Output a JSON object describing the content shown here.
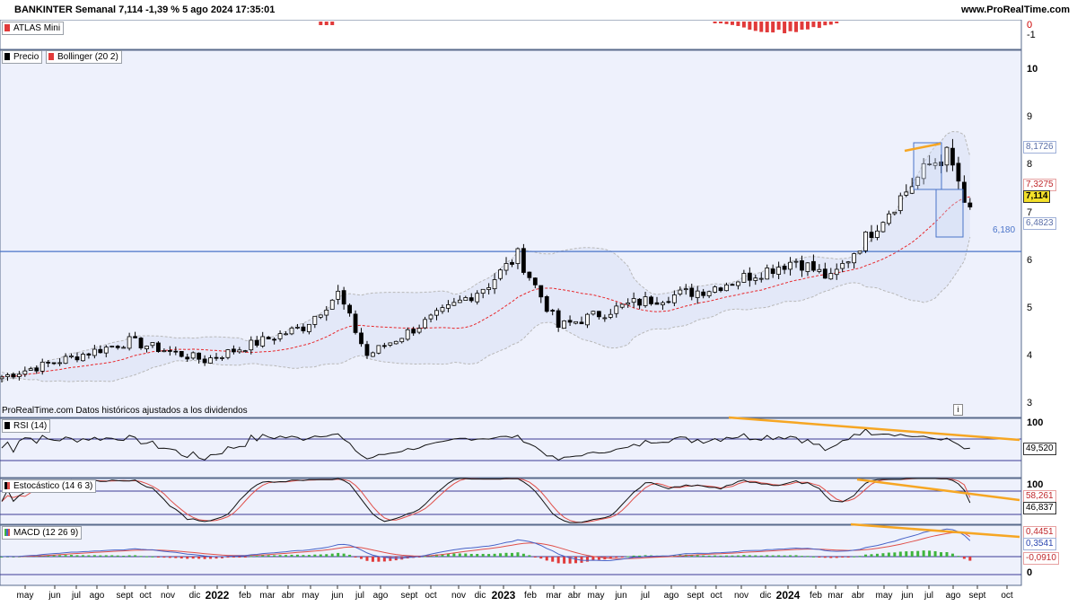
{
  "header": {
    "title": "BANKINTER Semanal 7,114 -1,39 % 5 ago 2024 17:35:01",
    "brand": "www.ProRealTime.com"
  },
  "panels": {
    "atlas": {
      "label": "ATLAS Mini",
      "ticks": [
        "0",
        "-1"
      ]
    },
    "price": {
      "legend_price": "Precio",
      "legend_bollinger": "Bollinger (20 2)",
      "footnote": "ProRealTime.com Datos históricos ajustados a los dividendos",
      "info_icon": "i",
      "level_label": "6,180",
      "tags": {
        "upper": "8,1726",
        "middle": "7,3275",
        "last": "7,114",
        "lower": "6,4823"
      }
    },
    "rsi": {
      "label": "RSI (14)",
      "tag": "49,520",
      "tick": "100"
    },
    "stoch": {
      "label": "Estocástico (14 6 3)",
      "tag_d": "58,261",
      "tag_k": "46,837",
      "tick": "100"
    },
    "macd": {
      "label": "MACD (12 26 9)",
      "tag_signal": "0,4451",
      "tag_macd": "0,3541",
      "tag_hist": "-0,0910",
      "tick": "0"
    }
  },
  "colors": {
    "up": "#ffffff",
    "down": "#000000",
    "bollinger_mid": "#e8262a",
    "bollinger_band": "#b8b8b8",
    "trendline": "#f6a623",
    "level": "#4a74c9",
    "panel_bg": "#e9eefb",
    "rsi_line": "#111111",
    "stoch_k": "#111111",
    "stoch_d": "#e0504a",
    "macd_line": "#4863c7",
    "signal_line": "#e0504a",
    "hist_pos": "#3fb53f",
    "hist_neg": "#e13a3a",
    "atlas": "#e13a3a"
  },
  "chart_data": {
    "type": "candlestick",
    "title": "BANKINTER Semanal 7,114 -1,39 % 5 ago 2024 17:35:01",
    "x_axis_labels": [
      "may",
      "jun",
      "jul",
      "ago",
      "sept",
      "oct",
      "nov",
      "dic",
      "2022",
      "feb",
      "mar",
      "abr",
      "may",
      "jun",
      "jul",
      "ago",
      "sept",
      "oct",
      "nov",
      "dic",
      "2023",
      "feb",
      "mar",
      "abr",
      "may",
      "jun",
      "jul",
      "ago",
      "sept",
      "oct",
      "nov",
      "dic",
      "2024",
      "feb",
      "mar",
      "abr",
      "may",
      "jun",
      "jul",
      "ago",
      "sept",
      "oct"
    ],
    "y_axis_price": {
      "ticks": [
        3,
        4,
        5,
        6,
        7,
        8,
        9,
        10
      ],
      "ylim": [
        2.7,
        10.4
      ]
    },
    "key_points": [
      {
        "x": "may 2021",
        "close": 3.55
      },
      {
        "x": "oct 2021",
        "close": 4.3
      },
      {
        "x": "ene 2022",
        "close": 3.9
      },
      {
        "x": "may 2022",
        "close": 4.6
      },
      {
        "x": "jun 2022",
        "close": 5.3
      },
      {
        "x": "jul 2022",
        "close": 4.0
      },
      {
        "x": "oct 2022",
        "close": 4.9
      },
      {
        "x": "dic 2022",
        "close": 5.5
      },
      {
        "x": "ene 2023",
        "close": 6.1
      },
      {
        "x": "mar 2023",
        "close": 4.6
      },
      {
        "x": "jun 2023",
        "close": 5.1
      },
      {
        "x": "sept 2023",
        "close": 5.4
      },
      {
        "x": "dic 2023",
        "close": 6.0
      },
      {
        "x": "feb 2024",
        "close": 5.6
      },
      {
        "x": "abr 2024",
        "close": 6.9
      },
      {
        "x": "jun 2024",
        "close": 8.0
      },
      {
        "x": "jul 2024",
        "close": 8.2
      },
      {
        "x": "ago 2024",
        "close": 7.114
      }
    ],
    "horizontal_level": 6.18,
    "bollinger_last": {
      "upper": 8.1726,
      "middle": 7.3275,
      "lower": 6.4823
    },
    "rsi_last": 49.52,
    "stoch_last": {
      "k": 46.837,
      "d": 58.261
    },
    "macd_last": {
      "macd": 0.3541,
      "signal": 0.4451,
      "hist": -0.091
    }
  }
}
